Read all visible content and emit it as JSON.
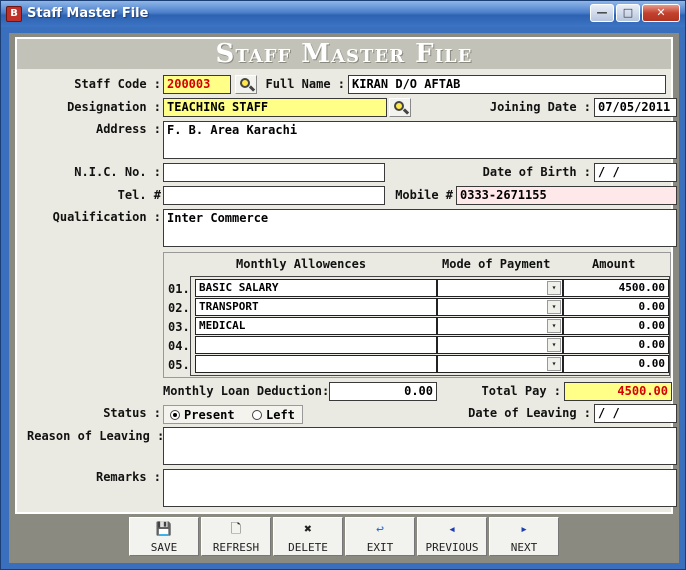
{
  "window": {
    "title": "Staff Master File",
    "minimize_glyph": "—",
    "maximize_glyph": "□",
    "close_glyph": "✕",
    "icon_letter": "B"
  },
  "form": {
    "heading": "Staff Master File",
    "labels": {
      "staff_code": "Staff Code :",
      "full_name": "Full Name :",
      "designation": "Designation :",
      "joining_date": "Joining Date :",
      "address": "Address :",
      "nic_no": "N.I.C. No. :",
      "date_of_birth": "Date of Birth :",
      "tel": "Tel. #",
      "mobile": "Mobile #",
      "qualification": "Qualification :",
      "monthly_loan_deduction": "Monthly Loan Deduction:",
      "total_pay": "Total Pay :",
      "status": "Status :",
      "date_of_leaving": "Date of Leaving :",
      "reason_of_leaving": "Reason of Leaving :",
      "remarks": "Remarks :"
    },
    "values": {
      "staff_code": "200003",
      "full_name": "KIRAN D/O AFTAB",
      "designation": "TEACHING STAFF",
      "joining_date": "07/05/2011",
      "address": "F. B. Area Karachi",
      "nic_no": "",
      "date_of_birth": " /  /",
      "tel": "",
      "mobile": "0333-2671155",
      "qualification": "Inter Commerce",
      "monthly_loan_deduction": "0.00",
      "total_pay": "4500.00",
      "date_of_leaving": " /  /",
      "reason_of_leaving": "",
      "remarks": ""
    },
    "status": {
      "options": [
        "Present",
        "Left"
      ],
      "selected": "Present"
    },
    "allowances": {
      "headers": {
        "allowance": "Monthly Allowences",
        "mode": "Mode of Payment",
        "amount": "Amount"
      },
      "dropdown_glyph": "▾",
      "rows": [
        {
          "no": "01.",
          "allowance": "BASIC SALARY",
          "mode": "",
          "amount": "4500.00"
        },
        {
          "no": "02.",
          "allowance": "TRANSPORT",
          "mode": "",
          "amount": "0.00"
        },
        {
          "no": "03.",
          "allowance": "MEDICAL",
          "mode": "",
          "amount": "0.00"
        },
        {
          "no": "04.",
          "allowance": "",
          "mode": "",
          "amount": "0.00"
        },
        {
          "no": "05.",
          "allowance": "",
          "mode": "",
          "amount": "0.00"
        }
      ]
    }
  },
  "toolbar": {
    "buttons": [
      {
        "key": "save",
        "label": "SAVE",
        "icon": "floppy-disk-icon",
        "glyph": "💾"
      },
      {
        "key": "refresh",
        "label": "REFRESH",
        "icon": "document-icon",
        "glyph": "🗋"
      },
      {
        "key": "delete",
        "label": "DELETE",
        "icon": "delete-x-icon",
        "glyph": "✖"
      },
      {
        "key": "exit",
        "label": "EXIT",
        "icon": "exit-icon",
        "glyph": "↩"
      },
      {
        "key": "previous",
        "label": "PREVIOUS",
        "icon": "arrow-left-icon",
        "glyph": "◂"
      },
      {
        "key": "next",
        "label": "NEXT",
        "icon": "arrow-right-icon",
        "glyph": "▸"
      }
    ]
  },
  "colors": {
    "highlight_yellow": "#ffff88",
    "required_red": "#d40000",
    "mobile_pink": "#ffe8ea",
    "form_bg": "#ebeae2"
  }
}
